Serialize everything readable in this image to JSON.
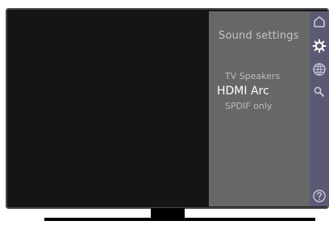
{
  "panel": {
    "title": "Sound settings",
    "options": [
      "TV Speakers",
      "HDMI Arc",
      "SPDIF only"
    ]
  },
  "sidebar": {
    "icons": [
      "home-icon",
      "settings-icon",
      "globe-icon",
      "search-icon",
      "help-icon"
    ]
  },
  "colors": {
    "panel_bg": "#676767",
    "sidebar_bg": "#5a5a74",
    "tv_bezel": "#151515",
    "active_text": "#ffffff"
  }
}
